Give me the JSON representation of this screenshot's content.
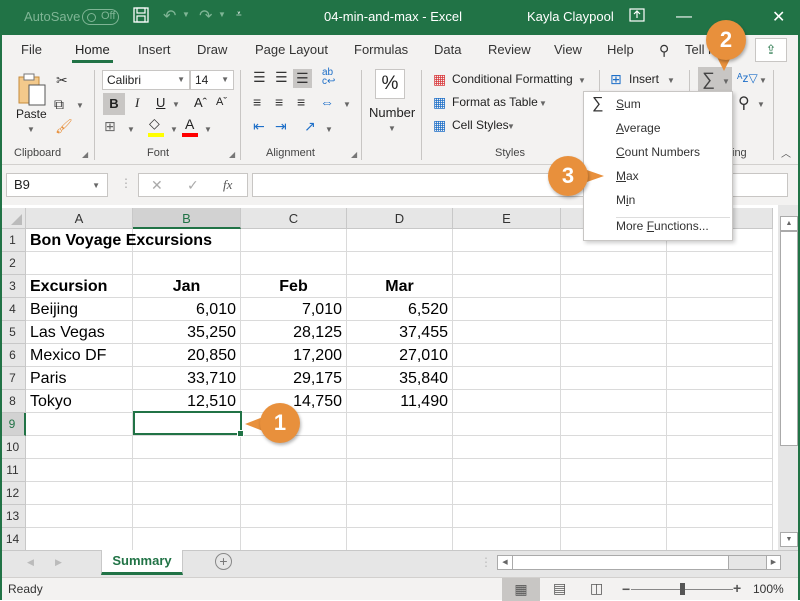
{
  "titlebar": {
    "autosave_label": "AutoSave",
    "autosave_state": "Off",
    "doc_title": "04-min-and-max  -  Excel",
    "user": "Kayla Claypool"
  },
  "tabs": [
    {
      "label": "File"
    },
    {
      "label": "Home",
      "active": true
    },
    {
      "label": "Insert"
    },
    {
      "label": "Draw"
    },
    {
      "label": "Page Layout"
    },
    {
      "label": "Formulas"
    },
    {
      "label": "Data"
    },
    {
      "label": "Review"
    },
    {
      "label": "View"
    },
    {
      "label": "Help"
    },
    {
      "label": "Tell me"
    }
  ],
  "ribbon": {
    "clipboard": {
      "label": "Clipboard",
      "paste": "Paste"
    },
    "font": {
      "label": "Font",
      "name": "Calibri",
      "size": "14",
      "fill_color": "#ffff00",
      "font_color": "#ff0000"
    },
    "alignment": {
      "label": "Alignment"
    },
    "number": {
      "label": "Number",
      "symbol": "%"
    },
    "styles": {
      "label": "Styles",
      "conditional": "Conditional Formatting",
      "format_table": "Format as Table",
      "cell_styles": "Cell Styles"
    },
    "cells": {
      "insert": "Insert"
    },
    "editing": {
      "label": "Editing",
      "visible_label": "ing"
    }
  },
  "formula_bar": {
    "name_box": "B9",
    "fx": "fx",
    "value": ""
  },
  "autosum_menu": {
    "items": [
      {
        "label": "Sum",
        "accel": "S",
        "rest": "um",
        "icon": "sigma"
      },
      {
        "label": "Average",
        "accel": "A",
        "rest": "verage"
      },
      {
        "label": "Count Numbers",
        "accel": "C",
        "rest": "ount Numbers"
      },
      {
        "label": "Max",
        "accel": "M",
        "rest": "ax"
      },
      {
        "label": "Min",
        "pre": "M",
        "accel": "i",
        "rest": "n"
      },
      {
        "label": "More Functions...",
        "pre": "More ",
        "accel": "F",
        "rest": "unctions..."
      }
    ]
  },
  "sheet": {
    "columns": [
      "A",
      "B",
      "C",
      "D",
      "E"
    ],
    "selected_column": "B",
    "selected_row": 9,
    "rows": [
      1,
      2,
      3,
      4,
      5,
      6,
      7,
      8,
      9,
      10,
      11,
      12,
      13,
      14
    ],
    "title": "Bon Voyage Excursions",
    "headers": [
      "Excursion",
      "Jan",
      "Feb",
      "Mar"
    ],
    "data": [
      [
        "Beijing",
        "6,010",
        "7,010",
        "6,520"
      ],
      [
        "Las Vegas",
        "35,250",
        "28,125",
        "37,455"
      ],
      [
        "Mexico DF",
        "20,850",
        "17,200",
        "27,010"
      ],
      [
        "Paris",
        "33,710",
        "29,175",
        "35,840"
      ],
      [
        "Tokyo",
        "12,510",
        "14,750",
        "11,490"
      ]
    ]
  },
  "sheet_tabs": [
    {
      "label": "Summary",
      "active": true
    }
  ],
  "status": {
    "text": "Ready",
    "zoom": "100%"
  },
  "callouts": [
    "1",
    "2",
    "3"
  ],
  "colors": {
    "brand": "#217346",
    "callout": "#e8903c"
  }
}
